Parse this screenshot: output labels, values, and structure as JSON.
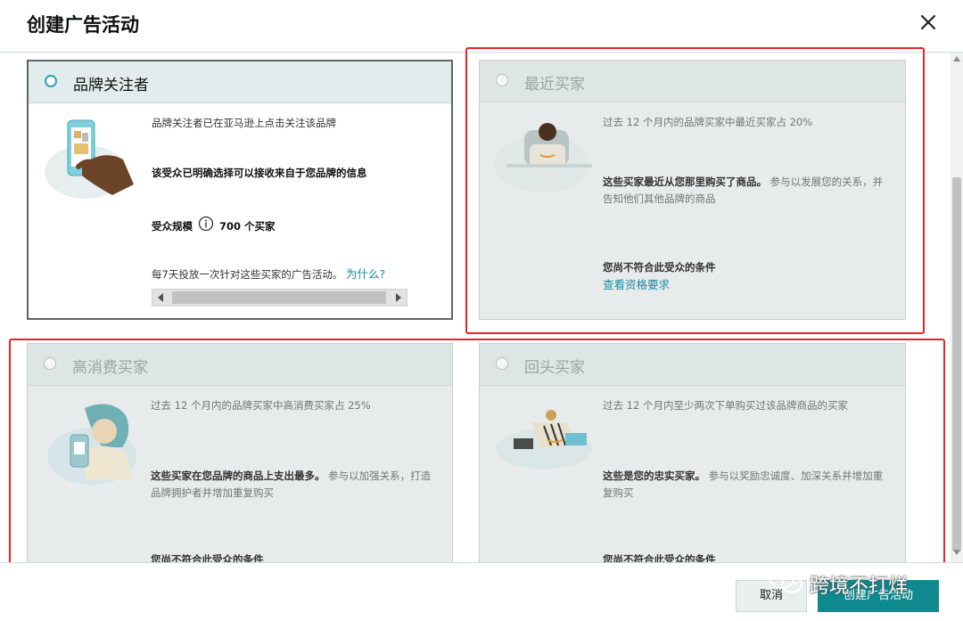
{
  "dialog": {
    "title": "创建广告活动"
  },
  "cards": {
    "brand_followers": {
      "title": "品牌关注者",
      "desc": "品牌关注者已在亚马逊上点击关注该品牌",
      "highlight": "该受众已明确选择可以接收来自于您品牌的信息",
      "size_label": "受众规模",
      "size_value": "700 个买家",
      "frequency_note": "每7天投放一次针对这些买家的广告活动。",
      "why_link": "为什么?"
    },
    "recent_buyers": {
      "title": "最近买家",
      "stat": "过去 12 个月内的品牌买家中最近买家占 20%",
      "desc_bold": "这些买家最近从您那里购买了商品。",
      "desc": "参与以发展您的关系，并告知他们其他品牌的商品",
      "ineligible": "您尚不符合此受众的条件",
      "requirements_link": "查看资格要求"
    },
    "high_spend_buyers": {
      "title": "高消费买家",
      "stat": "过去 12 个月内的品牌买家中高消费买家占 25%",
      "desc_bold": "这些买家在您品牌的商品上支出最多。",
      "desc": "参与以加强关系，打造品牌拥护者并增加重复购买",
      "ineligible": "您尚不符合此受众的条件"
    },
    "repeat_buyers": {
      "title": "回头买家",
      "stat": "过去 12 个月内至少两次下单购买过该品牌商品的买家",
      "desc_bold": "这些是您的忠实买家。",
      "desc": "参与以奖励忠诚度、加深关系并增加重复购买",
      "ineligible": "您尚不符合此受众的条件"
    }
  },
  "footer": {
    "cancel_label": "取消",
    "create_label": "创建广告活动",
    "watermark_text": "跨境不打烊"
  },
  "colors": {
    "accent": "#0e8a8f",
    "link": "#1a8aa0",
    "radio_selected": "#2e9cb9",
    "annotation_red": "#e52428"
  },
  "icons": [
    "close-icon",
    "info-icon",
    "wechat-icon"
  ]
}
